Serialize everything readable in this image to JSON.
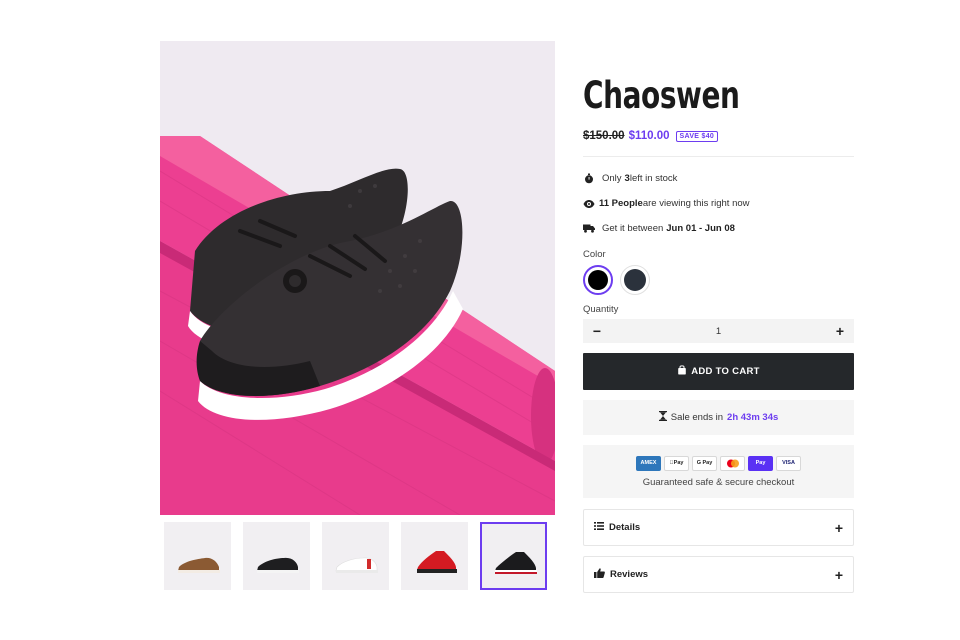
{
  "product": {
    "title": "Chaoswen",
    "old_price": "$150.00",
    "new_price": "$110.00",
    "save_badge": "SAVE $40"
  },
  "meta": {
    "stock_prefix": "Only",
    "stock_count": "3",
    "stock_suffix": "left in stock",
    "viewers_count": "11 People",
    "viewers_suffix": "are viewing this right now",
    "delivery_prefix": "Get it between",
    "delivery_range": "Jun 01 - Jun 08"
  },
  "options": {
    "color_label": "Color",
    "colors": [
      "#000000",
      "#2b323c"
    ],
    "quantity_label": "Quantity",
    "quantity_value": "1"
  },
  "actions": {
    "add_to_cart": "ADD TO CART"
  },
  "sale": {
    "prefix": "Sale ends in",
    "timer": "2h 43m 34s"
  },
  "payments": {
    "methods": [
      "AMEX",
      "Apple Pay",
      "G Pay",
      "Mastercard",
      "Shop Pay",
      "VISA"
    ],
    "labels": {
      "amex": "AMEX",
      "apple": "Pay",
      "google": "G Pay",
      "shop": "Pay",
      "visa": "VISA"
    },
    "caption": "Guaranteed safe & secure checkout"
  },
  "accordions": {
    "details": "Details",
    "reviews": "Reviews"
  },
  "icons": {
    "stock": "stopwatch-icon",
    "viewers": "eye-icon",
    "delivery": "truck-icon",
    "cart": "bag-icon",
    "sale": "hourglass-icon",
    "details": "list-icon",
    "reviews": "thumbs-up-icon"
  },
  "colors": {
    "accent": "#6d3df0",
    "button_dark": "#25282b",
    "mat_pink": "#ea3d8f"
  },
  "gallery": {
    "active_thumb_index": 4,
    "thumbnails": [
      "brown-shoe",
      "black-shoe",
      "white-shoe",
      "red-sock-shoe",
      "black-sock-shoe"
    ]
  }
}
